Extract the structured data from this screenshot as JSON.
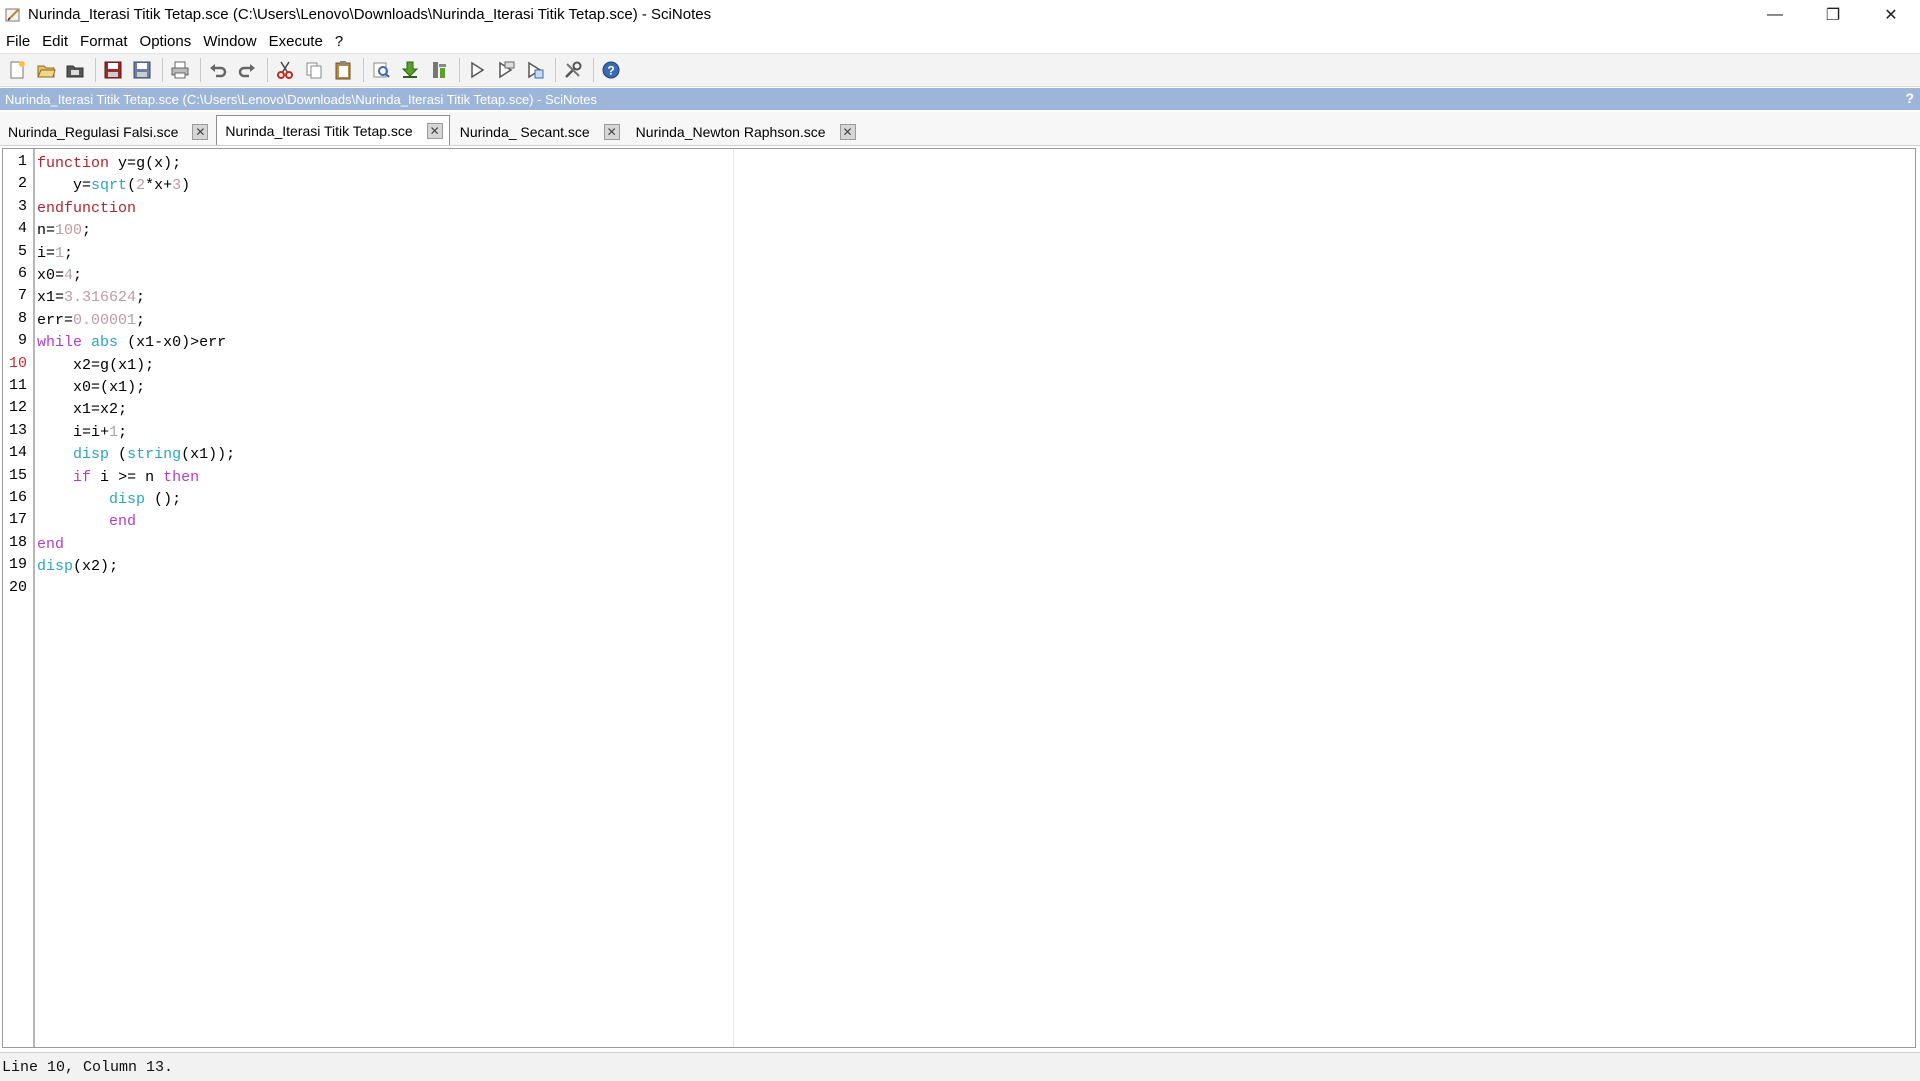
{
  "window": {
    "title": "Nurinda_Iterasi Titik Tetap.sce (C:\\Users\\Lenovo\\Downloads\\Nurinda_Iterasi Titik Tetap.sce) - SciNotes",
    "controls": {
      "minimize": "—",
      "restore": "❐",
      "close": "✕"
    }
  },
  "menu": {
    "items": [
      "File",
      "Edit",
      "Format",
      "Options",
      "Window",
      "Execute",
      "?"
    ]
  },
  "toolbar": {
    "icons": [
      "new-file-icon",
      "open-file-icon",
      "open-folder-icon",
      "save-icon",
      "save-as-icon",
      "print-icon",
      "undo-icon",
      "redo-icon",
      "cut-icon",
      "copy-icon",
      "paste-icon",
      "find-replace-icon",
      "load-into-scilab-icon",
      "execute-options-icon",
      "run-icon",
      "run-with-echo-icon",
      "run-file-icon",
      "settings-icon",
      "help-icon"
    ]
  },
  "docbar": {
    "title": "Nurinda_Iterasi Titik Tetap.sce (C:\\Users\\Lenovo\\Downloads\\Nurinda_Iterasi Titik Tetap.sce) - SciNotes",
    "help": "?"
  },
  "tabs": [
    {
      "label": "Nurinda_Regulasi Falsi.sce",
      "active": false
    },
    {
      "label": "Nurinda_Iterasi Titik Tetap.sce",
      "active": true
    },
    {
      "label": "Nurinda_ Secant.sce",
      "active": false
    },
    {
      "label": "Nurinda_Newton Raphson.sce",
      "active": false
    }
  ],
  "tab_close_glyph": "✕",
  "editor": {
    "current_line": 10,
    "lines": [
      "function y=g(x);",
      "    y=sqrt(2*x+3)",
      "endfunction",
      "n=100;",
      "i=1;",
      "x0=4;",
      "x1=3.316624;",
      "err=0.00001;",
      "while abs (x1-x0)>err",
      "    x2=g(x1);",
      "    x0=(x1);",
      "    x1=x2;",
      "    i=i+1;",
      "    disp (string(x1));",
      "    if i >= n then",
      "        disp ();",
      "        end",
      "end",
      "disp(x2);",
      ""
    ]
  },
  "status": {
    "text": "Line 10, Column 13."
  },
  "colors": {
    "keyword": "#b0262a",
    "control": "#b03dd2",
    "builtin": "#2aa4c8",
    "number": "#c09aa4",
    "docbar": "#9db5d9"
  }
}
